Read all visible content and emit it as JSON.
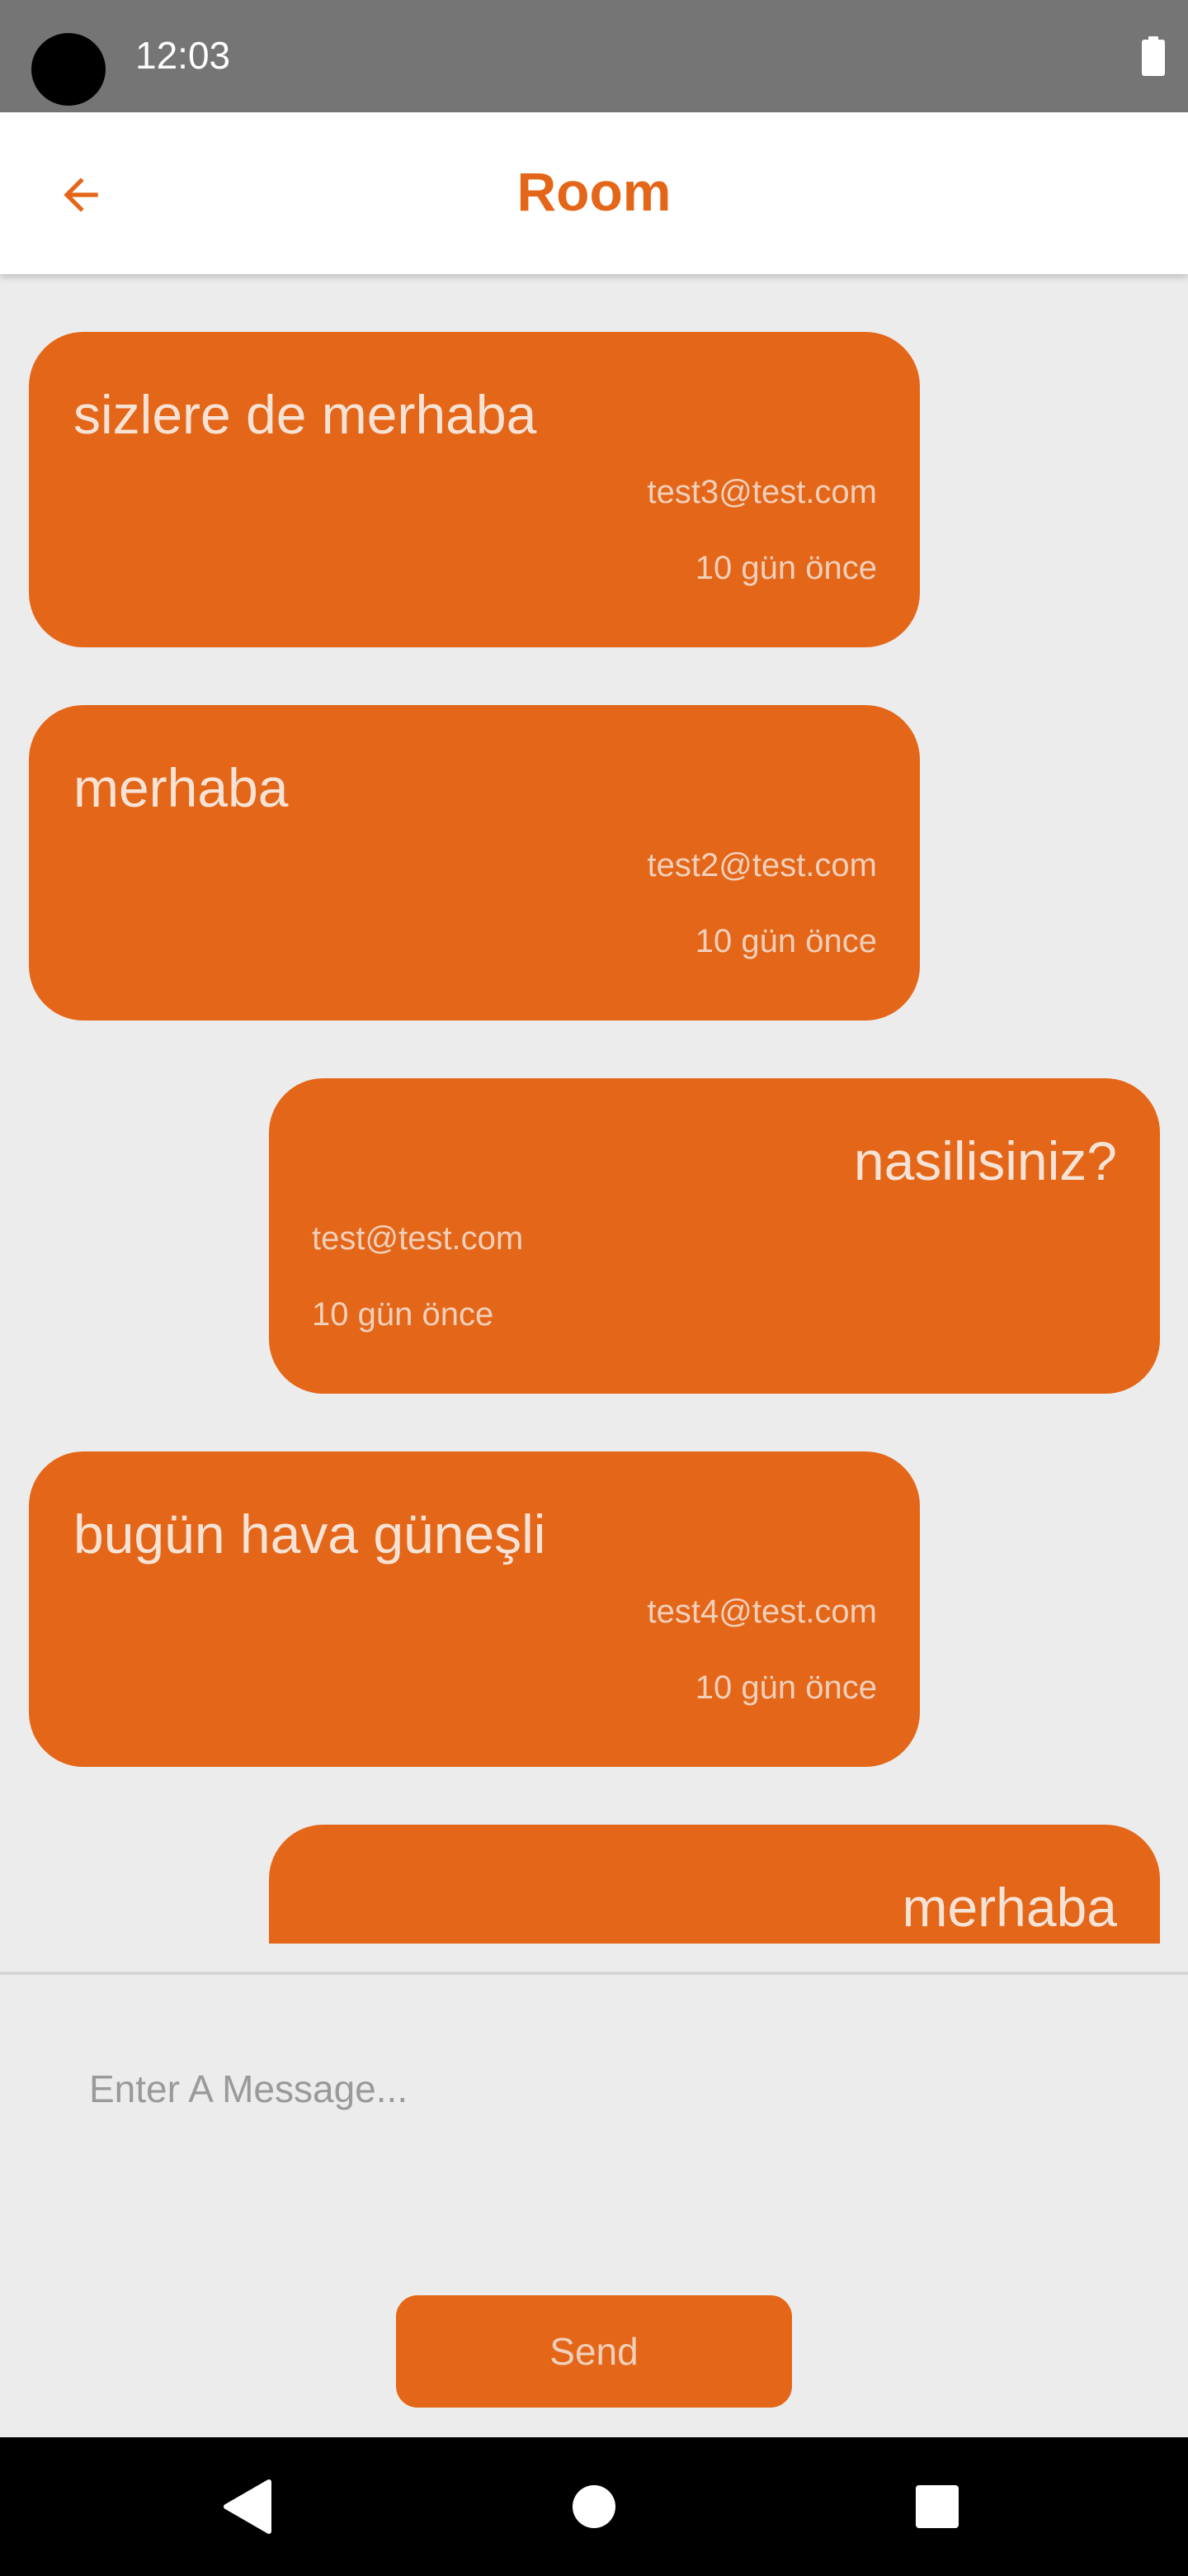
{
  "status_bar": {
    "time": "12:03",
    "battery_icon": "battery-icon"
  },
  "app_bar": {
    "title": "Room",
    "back_icon": "arrow-left-icon"
  },
  "colors": {
    "accent": "#e46618",
    "background": "#ececec",
    "status_bar": "#757575"
  },
  "messages": [
    {
      "text": "sizlere de merhaba",
      "sender": "test3@test.com",
      "time": "10 gün önce",
      "side": "left"
    },
    {
      "text": "merhaba",
      "sender": "test2@test.com",
      "time": "10 gün önce",
      "side": "left"
    },
    {
      "text": "nasilisiniz?",
      "sender": "test@test.com",
      "time": "10 gün önce",
      "side": "right"
    },
    {
      "text": "bugün hava güneşli",
      "sender": "test4@test.com",
      "time": "10 gün önce",
      "side": "left"
    },
    {
      "text": "merhaba",
      "sender": "",
      "time": "",
      "side": "right"
    }
  ],
  "composer": {
    "placeholder": "Enter A Message...",
    "value": "",
    "send_label": "Send"
  },
  "nav_bar": {
    "back_icon": "nav-back-icon",
    "home_icon": "nav-home-icon",
    "recents_icon": "nav-recents-icon"
  }
}
